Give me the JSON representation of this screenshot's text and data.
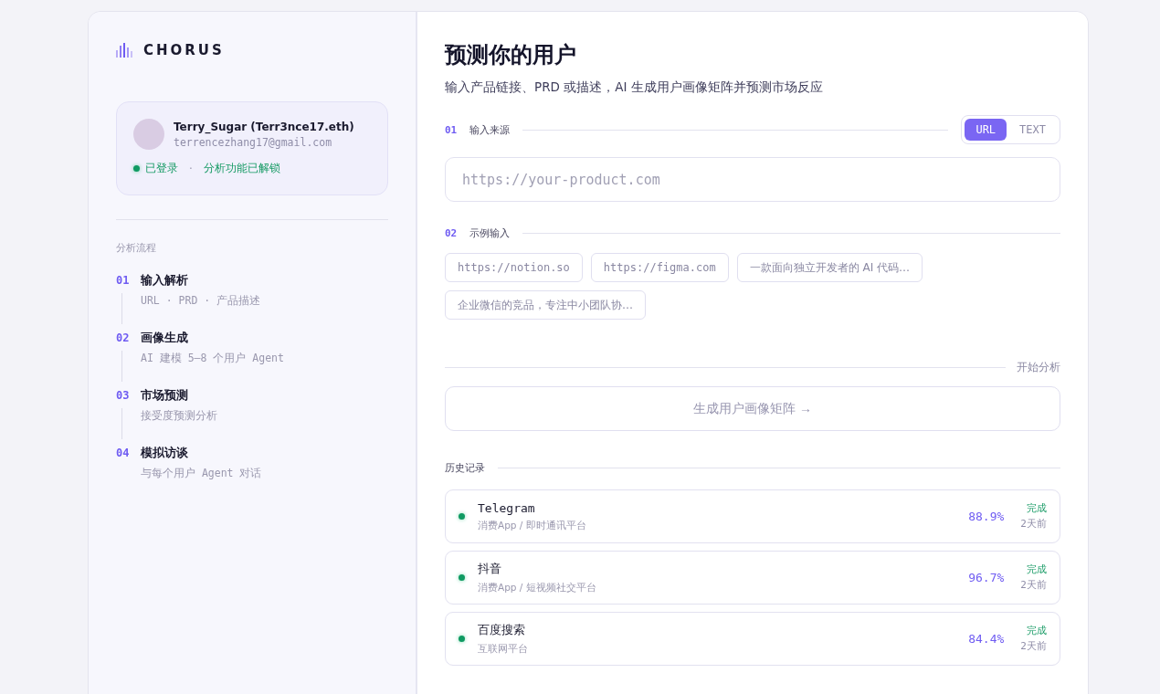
{
  "brand": {
    "name": "CHORUS"
  },
  "user": {
    "name": "Terry_Sugar (Terr3nce17.eth)",
    "email": "terrencezhang17@gmail.com",
    "status": "已登录",
    "separator": "·",
    "unlock": "分析功能已解锁"
  },
  "flow": {
    "heading": "分析流程",
    "steps": [
      {
        "number": "01",
        "title": "输入解析",
        "subtitle": "URL · PRD · 产品描述"
      },
      {
        "number": "02",
        "title": "画像生成",
        "subtitle": "AI 建模 5–8 个用户 Agent"
      },
      {
        "number": "03",
        "title": "市场预测",
        "subtitle": "接受度预测分析"
      },
      {
        "number": "04",
        "title": "模拟访谈",
        "subtitle": "与每个用户 Agent 对话"
      }
    ]
  },
  "main": {
    "title": "预测你的用户",
    "subtitle": "输入产品链接、PRD 或描述，AI 生成用户画像矩阵并预测市场反应"
  },
  "source": {
    "number": "01",
    "label": "输入来源",
    "tabs": [
      {
        "label": "URL",
        "selected": true
      },
      {
        "label": "TEXT",
        "selected": false
      }
    ],
    "placeholder": "https://your-product.com"
  },
  "examples": {
    "number": "02",
    "label": "示例输入",
    "items": [
      {
        "text": "https://notion.so",
        "kind": "url"
      },
      {
        "text": "https://figma.com",
        "kind": "url"
      },
      {
        "text": "一款面向独立开发者的 AI 代码…",
        "kind": "text"
      },
      {
        "text": "企业微信的竞品，专注中小团队协…",
        "kind": "text"
      }
    ]
  },
  "start": {
    "label": "开始分析",
    "button": "生成用户画像矩阵 →"
  },
  "history": {
    "heading": "历史记录",
    "items": [
      {
        "title": "Telegram",
        "kind": "latin",
        "category": "消费App / 即时通讯平台",
        "score": "88.9%",
        "status": "完成",
        "time": "2天前"
      },
      {
        "title": "抖音",
        "kind": "cjk",
        "category": "消费App / 短视频社交平台",
        "score": "96.7%",
        "status": "完成",
        "time": "2天前"
      },
      {
        "title": "百度搜索",
        "kind": "cjk",
        "category": "互联网平台",
        "score": "84.4%",
        "status": "完成",
        "time": "2天前"
      }
    ]
  }
}
